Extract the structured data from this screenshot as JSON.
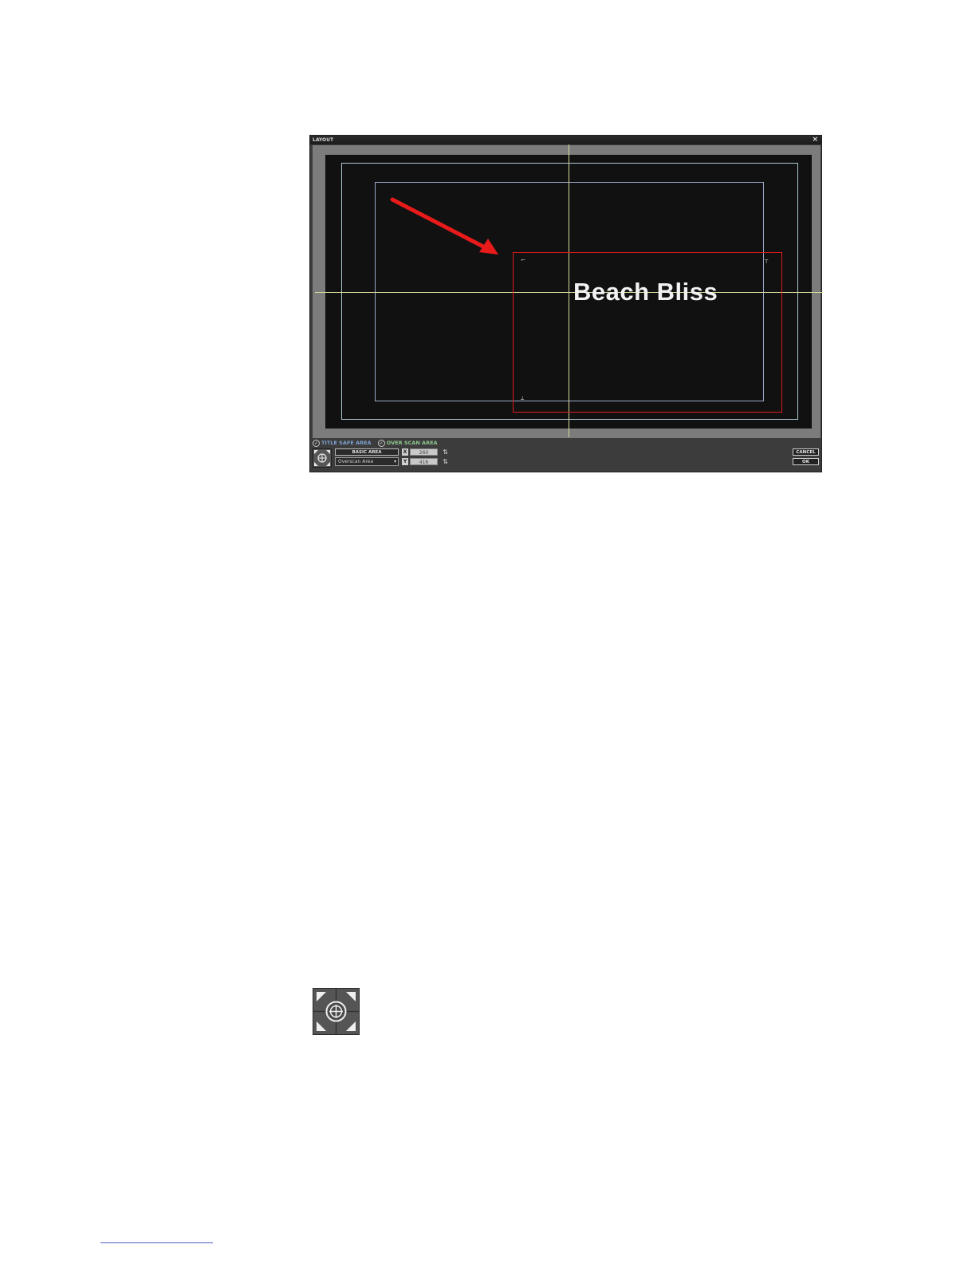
{
  "window": {
    "title": "LAYOUT",
    "close_glyph": "×"
  },
  "canvas": {
    "text": "Beach Bliss",
    "guides": {
      "overscan_color": "#a9c8ce",
      "title_safe_color": "#9aa8c8",
      "crosshair_color": "#d6d79a",
      "selection_color": "#e01a1a"
    },
    "annotation_arrow_color": "#e81a1a"
  },
  "controls": {
    "title_safe_label": "TITLE SAFE AREA",
    "title_safe_checked": true,
    "overscan_label": "OVER SCAN AREA",
    "overscan_checked": true,
    "area_header": "BASIC AREA",
    "area_select_value": "Overscan Area",
    "x_label": "X",
    "x_value": "260",
    "y_label": "Y",
    "y_value": "416",
    "cancel_label": "CANCEL",
    "ok_label": "OK"
  },
  "icons": {
    "move": "move-crosshair-icon",
    "spin": "spin-arrows-icon",
    "check": "check-circle-icon"
  }
}
